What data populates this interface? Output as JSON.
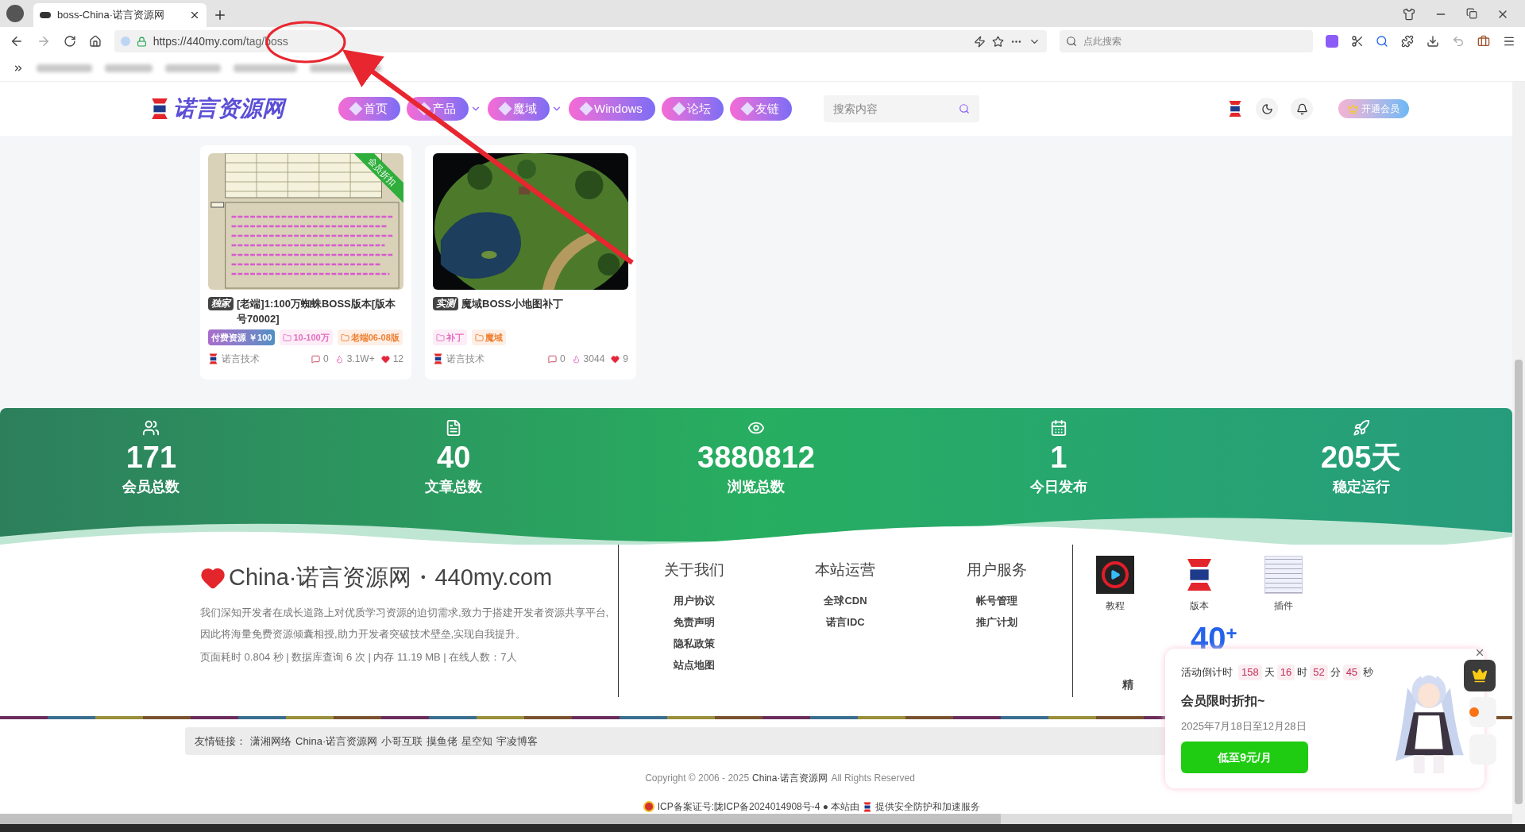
{
  "browser": {
    "tab_title": "boss-China·诺言资源网",
    "url_host": "https://440my.com/",
    "url_path": "tag/boss",
    "search_placeholder": "点此搜索"
  },
  "site": {
    "logo": "诺言资源网",
    "search_placeholder": "搜索内容",
    "vip_button": "开通会员",
    "nav": [
      {
        "label": "首页",
        "dropdown": false
      },
      {
        "label": "产品",
        "dropdown": true
      },
      {
        "label": "魔域",
        "dropdown": true
      },
      {
        "label": "Windows",
        "dropdown": false
      },
      {
        "label": "论坛",
        "dropdown": false
      },
      {
        "label": "友链",
        "dropdown": false
      }
    ]
  },
  "posts": [
    {
      "ribbon": "会员折扣",
      "badge": "独家",
      "title": "[老端]1:100万蜘蛛BOSS版本[版本号70002]",
      "author": "诺言技术",
      "comments": "0",
      "views": "3.1W+",
      "likes": "12",
      "tags": [
        {
          "kind": "price",
          "label": "付费资源 ￥100"
        },
        {
          "kind": "category",
          "label": "10-100万",
          "color": "#e46fc0"
        },
        {
          "kind": "category",
          "label": "老端06-08版",
          "color": "#ef7f2f"
        }
      ]
    },
    {
      "badge": "实测",
      "title": "魔域BOSS小地图补丁",
      "author": "诺言技术",
      "comments": "0",
      "views": "3044",
      "likes": "9",
      "tags": [
        {
          "kind": "category",
          "label": "补丁",
          "color": "#e46fc0"
        },
        {
          "kind": "category",
          "label": "魔域",
          "color": "#ef7f2f"
        }
      ]
    }
  ],
  "stats": [
    {
      "value": "171",
      "label": "会员总数"
    },
    {
      "value": "40",
      "label": "文章总数"
    },
    {
      "value": "3880812",
      "label": "浏览总数"
    },
    {
      "value": "1",
      "label": "今日发布"
    },
    {
      "value": "205天",
      "label": "稳定运行"
    }
  ],
  "footer": {
    "brand": "China·诺言资源网・440my.com",
    "description": "我们深知开发者在成长道路上对优质学习资源的迫切需求,致力于搭建开发者资源共享平台,因此将海量免费资源倾囊相授,助力开发者突破技术壁垒,实现自我提升。",
    "stats_line": "页面耗时 0.804 秒 | 数据库查询 6 次 | 内存 11.19 MB | 在线人数：7人",
    "link_columns": [
      {
        "title": "关于我们",
        "links": [
          "用户协议",
          "免责声明",
          "隐私政策",
          "站点地图"
        ]
      },
      {
        "title": "本站运营",
        "links": [
          "全球CDN",
          "诺言IDC"
        ]
      },
      {
        "title": "用户服务",
        "links": [
          "帐号管理",
          "推广计划"
        ]
      }
    ],
    "shortcuts": [
      "教程",
      "版本",
      "插件"
    ],
    "count": "40",
    "count_sup": "+",
    "partial_label": "精"
  },
  "friend_links": {
    "label": "友情链接：",
    "links": [
      "潇湘网络",
      "China·诺言资源网",
      "小哥互联",
      "摸鱼佬",
      "星空知",
      "宇凌博客"
    ]
  },
  "copyright": {
    "prefix": "Copyright © 2006 - 2025",
    "site": "China·诺言资源网",
    "suffix": "All Rights Reserved"
  },
  "icp": {
    "text": "ICP备案证号:陇ICP备2024014908号-4 ● 本站由",
    "suffix": "提供安全防护和加速服务"
  },
  "popup": {
    "countdown_label": "活动倒计时",
    "title": "会员限时折扣~",
    "dates": "2025年7月18日至12月28日",
    "button": "低至9元/月",
    "countdown": [
      {
        "value": "158",
        "unit": "天"
      },
      {
        "value": "16",
        "unit": "时"
      },
      {
        "value": "52",
        "unit": "分"
      },
      {
        "value": "45",
        "unit": "秒"
      }
    ]
  }
}
